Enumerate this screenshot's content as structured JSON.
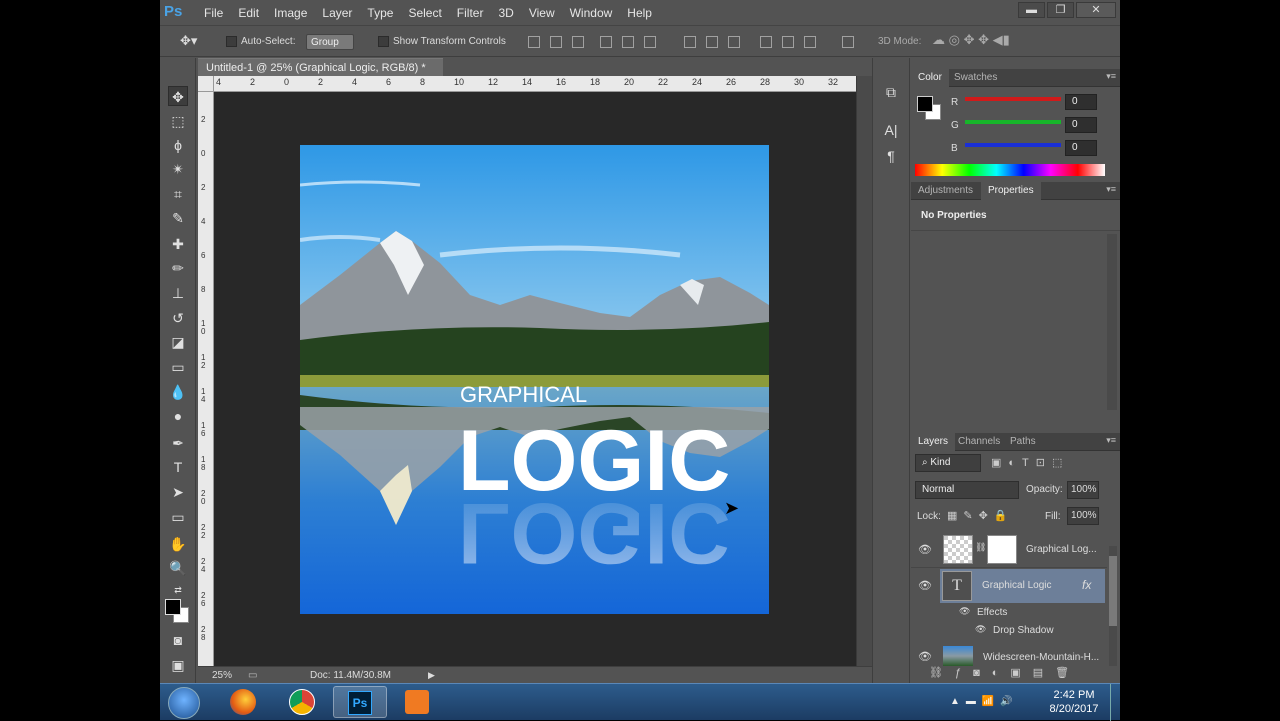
{
  "app": {
    "logo": "Ps"
  },
  "menu": [
    "File",
    "Edit",
    "Image",
    "Layer",
    "Type",
    "Select",
    "Filter",
    "3D",
    "View",
    "Window",
    "Help"
  ],
  "window_buttons": {
    "minimize": "▬",
    "restore": "❐",
    "close": "✕"
  },
  "options_bar": {
    "auto_select_label": "Auto-Select:",
    "auto_select_value": "Group",
    "show_transform_label": "Show Transform Controls",
    "mode_3d_label": "3D Mode:"
  },
  "document": {
    "tab_title": "Untitled-1 @ 25% (Graphical Logic, RGB/8) *",
    "tab_close": "×",
    "art_text_small": "GRAPHICAL",
    "art_text_big": "LOGIC",
    "art_text_reflection": "LOGIC"
  },
  "ruler_h": [
    "4",
    "2",
    "0",
    "2",
    "4",
    "6",
    "8",
    "10",
    "12",
    "14",
    "16",
    "18",
    "20",
    "22",
    "24",
    "26",
    "28",
    "30",
    "32"
  ],
  "ruler_v": [
    "2",
    "0",
    "2",
    "4",
    "6",
    "8",
    "10",
    "12",
    "14",
    "16",
    "18",
    "20",
    "22",
    "24",
    "26",
    "28"
  ],
  "status": {
    "zoom": "25%",
    "doc": "Doc: 11.4M/30.8M"
  },
  "color_panel": {
    "tabs": [
      "Color",
      "Swatches"
    ],
    "labels": [
      "R",
      "G",
      "B"
    ],
    "values": [
      "0",
      "0",
      "0"
    ],
    "channel_colors": [
      "#d11a1a",
      "#17b52a",
      "#1a2fd6"
    ]
  },
  "properties_panel": {
    "tabs": [
      "Adjustments",
      "Properties"
    ],
    "message": "No Properties"
  },
  "layers_panel": {
    "tabs": [
      "Layers",
      "Channels",
      "Paths"
    ],
    "kind_label": "Kind",
    "blend_mode": "Normal",
    "opacity_label": "Opacity:",
    "opacity_value": "100%",
    "lock_label": "Lock:",
    "fill_label": "Fill:",
    "fill_value": "100%",
    "layers": [
      {
        "name": "Graphical Log..."
      },
      {
        "name": "Graphical Logic",
        "fx": "fx"
      },
      {
        "name": "Widescreen-Mountain-H..."
      }
    ],
    "effects_label": "Effects",
    "drop_shadow_label": "Drop Shadow"
  },
  "taskbar": {
    "time": "2:42 PM",
    "date": "8/20/2017"
  }
}
